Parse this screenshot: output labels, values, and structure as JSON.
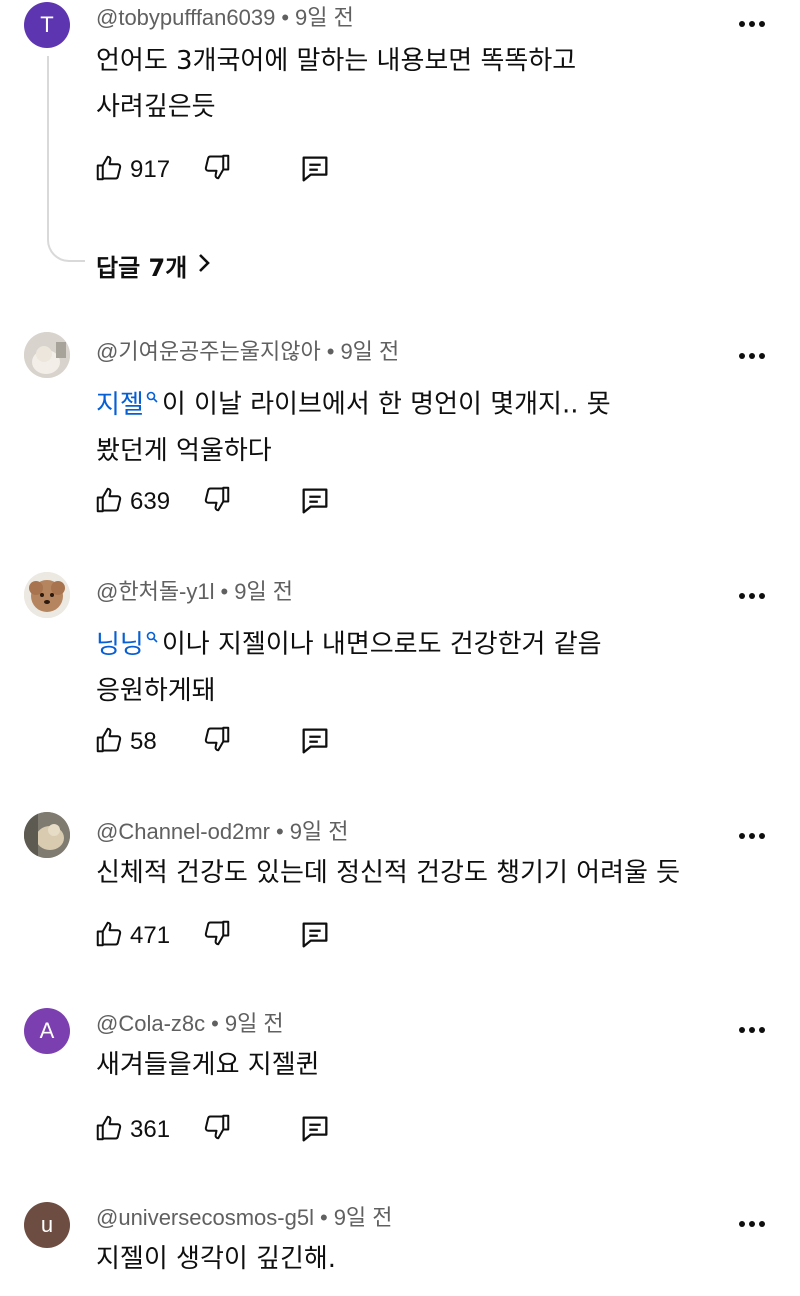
{
  "comments": [
    {
      "handle": "@tobypufffan6039",
      "time": "9일 전",
      "avatar_letter": "T",
      "avatar_color": "#5e35b1",
      "text_lines": [
        "언어도 3개국어에 말하는 내용보면 똑똑하고",
        "사려깊은듯"
      ],
      "likes": "917",
      "replies_label": "답글 7개"
    },
    {
      "handle": "@기여운공주는울지않아",
      "time": "9일 전",
      "mention": "지젤",
      "text_lines": [
        "이 이날 라이브에서 한 명언이 몇개지.. 못",
        "봤던게 억울하다"
      ],
      "likes": "639"
    },
    {
      "handle": "@한처돌-y1l",
      "time": "9일 전",
      "mention": "닝닝",
      "text_lines": [
        "이나 지젤이나 내면으로도 건강한거 같음",
        "응원하게돼"
      ],
      "likes": "58"
    },
    {
      "handle": "@Channel-od2mr",
      "time": "9일 전",
      "text_lines": [
        "신체적 건강도 있는데 정신적 건강도 챙기기 어려울 듯"
      ],
      "likes": "471"
    },
    {
      "handle": "@Cola-z8c",
      "time": "9일 전",
      "avatar_letter": "A",
      "avatar_color": "#7b3fb0",
      "text_lines": [
        "새겨들을게요 지젤퀸"
      ],
      "likes": "361"
    },
    {
      "handle": "@universecosmos-g5l",
      "time": "9일 전",
      "avatar_letter": "u",
      "avatar_color": "#6d4c41",
      "text_lines": [
        "지젤이 생각이 깊긴해."
      ]
    }
  ],
  "icons": {
    "like": "thumbs-up-icon",
    "dislike": "thumbs-down-icon",
    "reply": "reply-comment-icon",
    "more": "more-vertical-icon",
    "chevron": "chevron-right-icon",
    "mention": "search-icon"
  },
  "colors": {
    "mention": "#065fd4",
    "meta": "#606060",
    "text": "#0f0f0f"
  }
}
